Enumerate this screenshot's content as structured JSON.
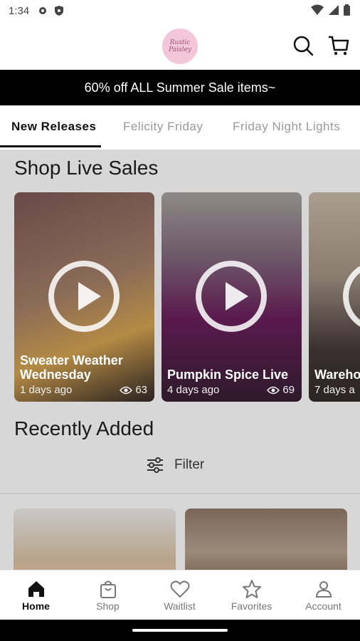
{
  "status_bar": {
    "time": "1:34"
  },
  "header": {
    "logo_text": "Rustic Paisley"
  },
  "banner": {
    "text": "60% off ALL Summer Sale items~"
  },
  "tabs": [
    {
      "label": "New Releases"
    },
    {
      "label": "Felicity Friday"
    },
    {
      "label": "Friday Night Lights"
    }
  ],
  "live_sales": {
    "title": "Shop Live Sales",
    "cards": [
      {
        "title": "Sweater Weather Wednesday",
        "date": "1 days ago",
        "views": "63"
      },
      {
        "title": "Pumpkin Spice Live",
        "date": "4 days ago",
        "views": "69"
      },
      {
        "title": "Wareho",
        "date": "7 days a",
        "views": ""
      }
    ]
  },
  "recently_added": {
    "title": "Recently Added",
    "filter_label": "Filter"
  },
  "bottom_nav": [
    {
      "label": "Home",
      "icon": "home-icon"
    },
    {
      "label": "Shop",
      "icon": "shopping-bag-icon"
    },
    {
      "label": "Waitlist",
      "icon": "heart-icon"
    },
    {
      "label": "Favorites",
      "icon": "star-icon"
    },
    {
      "label": "Account",
      "icon": "person-icon"
    }
  ]
}
